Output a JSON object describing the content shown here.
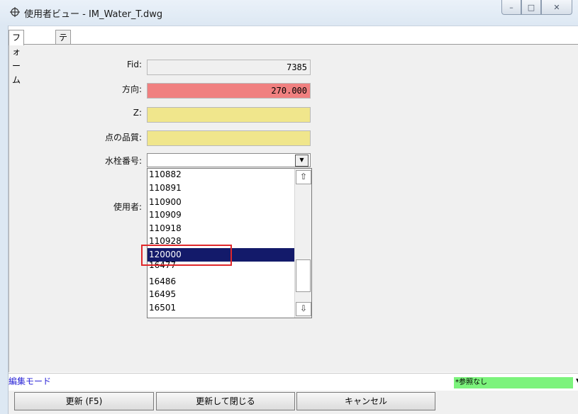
{
  "window": {
    "title": "使用者ビュー - IM_Water_T.dwg",
    "icon": "crosshair-icon",
    "controls": {
      "minimize": "minimize-icon",
      "maximize": "maximize-icon",
      "close": "close-icon"
    }
  },
  "tabs": [
    {
      "label": "フォーム",
      "active": true
    },
    {
      "label": "テーブル",
      "active": false
    }
  ],
  "form": {
    "fid": {
      "label": "Fid:",
      "value": "7385"
    },
    "direction": {
      "label": "方向:",
      "value": "270.000",
      "color": "#f08080"
    },
    "z": {
      "label": "Z:",
      "value": "",
      "color": "#f0e68c"
    },
    "quality": {
      "label": "点の品質:",
      "value": "",
      "color": "#f0e68c"
    },
    "hydrant": {
      "label": "水栓番号:",
      "value": ""
    },
    "user": {
      "label": "使用者:"
    }
  },
  "dropdown": {
    "items": [
      "110882",
      "110891",
      "110900",
      "110909",
      "110918",
      "110928",
      "120000",
      "16477",
      "16486",
      "16495",
      "16501"
    ],
    "selected": "120000",
    "selected_color": "#131a6a",
    "scroll_up": "arrow-up-icon",
    "scroll_down": "arrow-down-icon"
  },
  "status": {
    "mode": "編集モード",
    "reference": "*参照なし",
    "reference_color": "#7cf37c"
  },
  "buttons": {
    "update": "更新 (F5)",
    "update_close": "更新して閉じる",
    "cancel": "キャンセル"
  }
}
